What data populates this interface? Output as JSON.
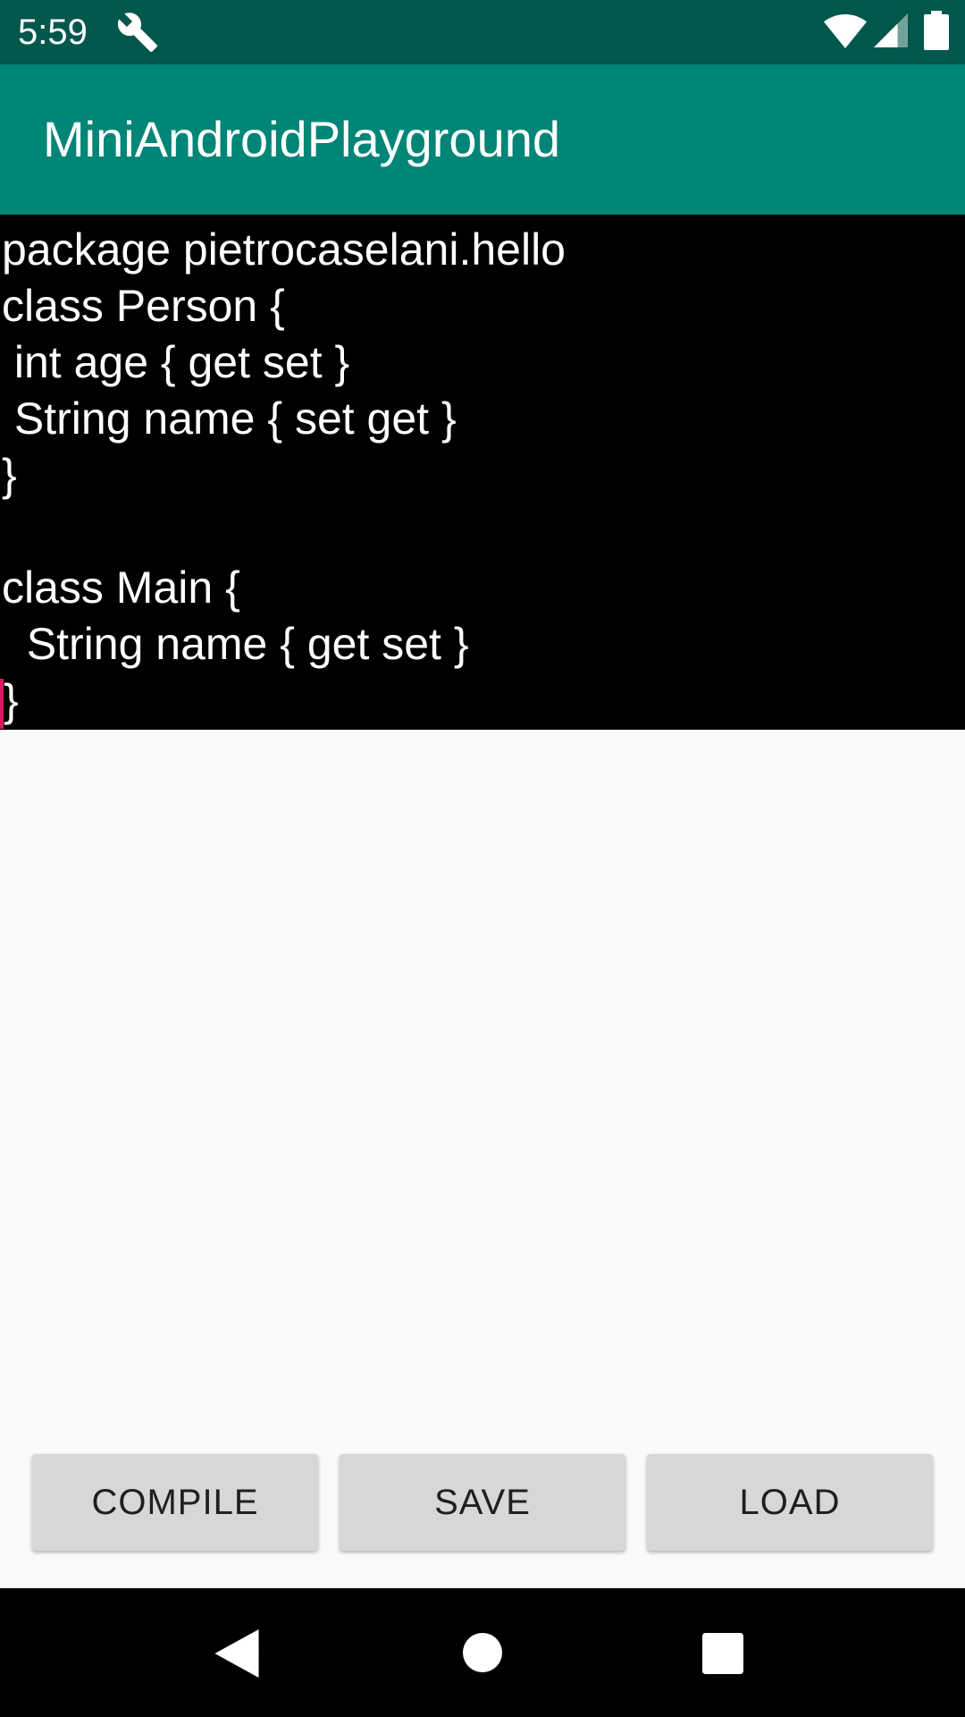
{
  "status_bar": {
    "time": "5:59",
    "icons": [
      "wrench-icon",
      "wifi-icon",
      "cell-signal-icon",
      "battery-icon"
    ],
    "color": "#00574b"
  },
  "app_bar": {
    "title": "MiniAndroidPlayground",
    "color": "#008577"
  },
  "editor": {
    "background": "#000000",
    "text_color": "#ffffff",
    "cursor_color": "#d81b60",
    "lines": [
      "package pietrocaselani.hello",
      "class Person {",
      " int age { get set }",
      " String name { set get }",
      "}",
      "",
      "class Main {",
      "  String name { get set }",
      "}"
    ]
  },
  "buttons": {
    "compile": "COMPILE",
    "save": "SAVE",
    "load": "LOAD"
  },
  "nav_bar": {
    "icons": [
      "back-icon",
      "home-icon",
      "recents-icon"
    ]
  }
}
